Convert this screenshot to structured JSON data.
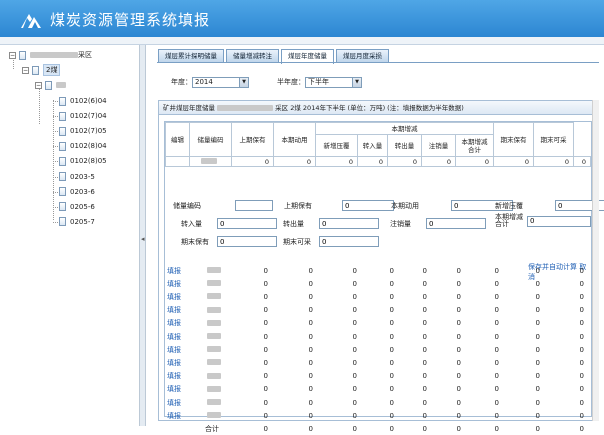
{
  "app": {
    "title": "煤炭资源管理系统填报"
  },
  "tree": {
    "root_suffix": "采区",
    "child": "2煤",
    "leaves": [
      "0102(6)04",
      "0102(7)04",
      "0102(7)05",
      "0102(8)04",
      "0102(8)05",
      "0203-5",
      "0203-6",
      "0205-6",
      "0205-7"
    ]
  },
  "tabs": [
    "煤层累计探明储量",
    "储量增减转注",
    "煤层年度储量",
    "煤层月度采损"
  ],
  "active_tab": 2,
  "filters": {
    "year_label": "年度：",
    "year_value": "2014",
    "half_label": "半年度：",
    "half_value": "下半年"
  },
  "panel": {
    "title_prefix": "矿井煤层年度储量",
    "title_suffix": "采区 2煤 2014年下半年 (单位：万吨) (注：填报数据为半年数据)"
  },
  "columns": {
    "edit": "编辑",
    "code": "储量编码",
    "begin": "上期保有",
    "used": "本期动用",
    "group": "本期增减",
    "new": "新增压覆",
    "in": "转入量",
    "out": "转出量",
    "cancel": "注销量",
    "sum_l1": "本期增减",
    "sum_l2": "合计",
    "end": "期末保有",
    "mine": "期末可采"
  },
  "summary_row": [
    "0",
    "0",
    "0",
    "0",
    "0",
    "0",
    "0",
    "0",
    "0",
    "0"
  ],
  "form": {
    "code": "储量编码",
    "begin": "上期保有",
    "used": "本期动用",
    "new": "新增压覆",
    "in": "转入量",
    "out": "转出量",
    "cancel": "注销量",
    "sum_l1": "本期增减",
    "sum_l2": "合计",
    "end": "期末保有",
    "mine": "期末可采",
    "zero": "0",
    "save": "保存并自动计算",
    "cancel_link": "取消"
  },
  "rows": {
    "action": "填报",
    "zero": "0",
    "count": 12,
    "total_label": "合计"
  }
}
